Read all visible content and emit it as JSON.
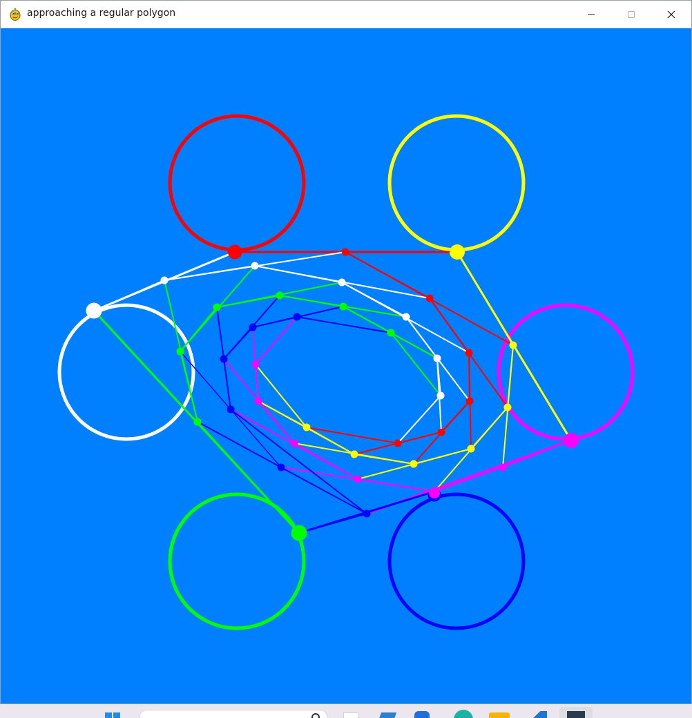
{
  "window": {
    "title": "approaching a regular polygon",
    "app_icon": "pygame-snake-icon",
    "controls": {
      "minimize_icon": "minimize-icon",
      "maximize_icon": "maximize-icon",
      "close_icon": "close-icon"
    }
  },
  "canvas": {
    "background": "#0080ff",
    "circles": [
      {
        "name": "red-circle",
        "color": "#ff0000"
      },
      {
        "name": "yellow-circle",
        "color": "#ffff00"
      },
      {
        "name": "magenta-circle",
        "color": "#ff00ff"
      },
      {
        "name": "blue-circle",
        "color": "#0000ff"
      },
      {
        "name": "green-circle",
        "color": "#00ff00"
      },
      {
        "name": "white-circle",
        "color": "#ffffff"
      }
    ],
    "trails": [
      {
        "name": "red-trail",
        "color": "#ff0000"
      },
      {
        "name": "yellow-trail",
        "color": "#ffff00"
      },
      {
        "name": "magenta-trail",
        "color": "#ff00ff"
      },
      {
        "name": "blue-trail",
        "color": "#0000ff"
      },
      {
        "name": "green-trail",
        "color": "#00ff00"
      },
      {
        "name": "white-trail",
        "color": "#ffffff"
      }
    ]
  },
  "taskbar": {
    "items": [
      "windows-start-icon",
      "search-box",
      "task-view-icon",
      "widgets-icon",
      "edge-icon",
      "file-explorer-icon",
      "vscode-icon",
      "terminal-icon"
    ]
  }
}
